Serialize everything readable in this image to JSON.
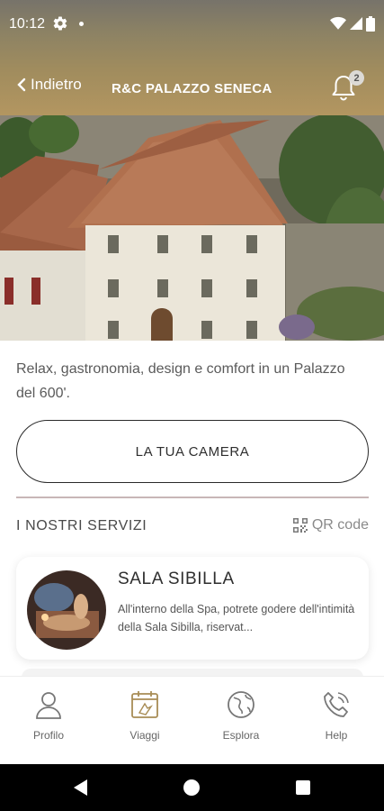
{
  "status_bar": {
    "time": "10:12"
  },
  "nav": {
    "back_label": "Indietro",
    "title": "R&C PALAZZO SENECA",
    "notification_count": "2"
  },
  "description": "Relax, gastronomia, design e comfort in un Palazzo del 600'.",
  "room_button_label": "LA TUA CAMERA",
  "services": {
    "title": "I NOSTRI SERVIZI",
    "qr_label": "QR code",
    "items": [
      {
        "title": "SALA SIBILLA",
        "description": "All'interno della Spa, potrete godere dell'intimità della Sala Sibilla, riservat..."
      }
    ]
  },
  "tabs": [
    {
      "label": "Profilo",
      "icon": "person-icon"
    },
    {
      "label": "Viaggi",
      "icon": "calendar-icon"
    },
    {
      "label": "Esplora",
      "icon": "globe-icon"
    },
    {
      "label": "Help",
      "icon": "phone-icon"
    }
  ],
  "colors": {
    "header_top": "#77736a",
    "header_bottom": "#b39660",
    "divider": "#c8b6b7",
    "accent_gold": "#a88c55"
  }
}
